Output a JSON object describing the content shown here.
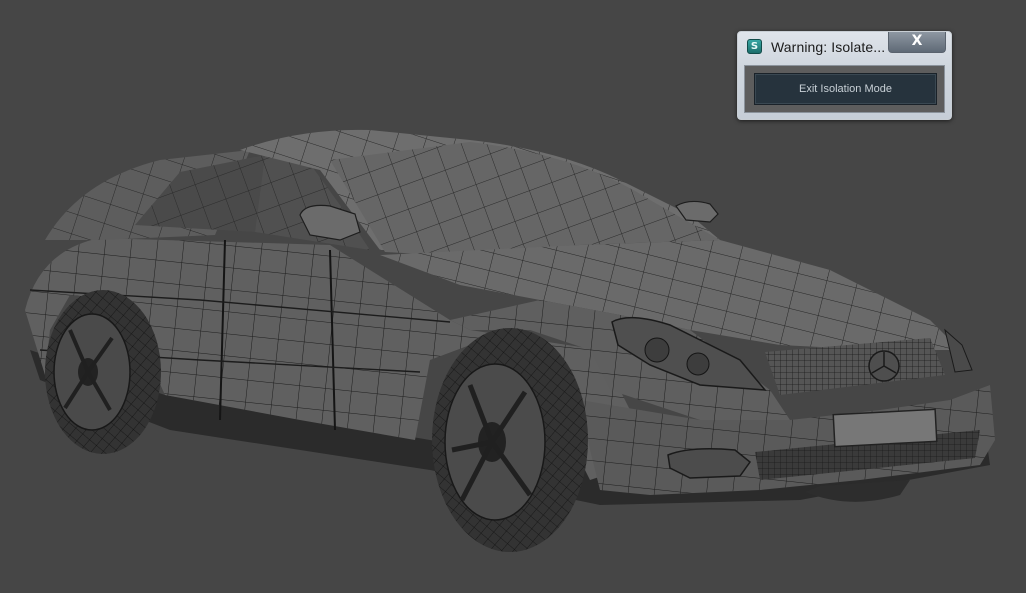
{
  "viewport": {
    "background": "#464646",
    "content": "car-wireframe-model"
  },
  "dialog": {
    "title": "Warning: Isolate...",
    "close_label": "X",
    "app_icon_glyph": "S",
    "exit_button_label": "Exit Isolation Mode"
  }
}
